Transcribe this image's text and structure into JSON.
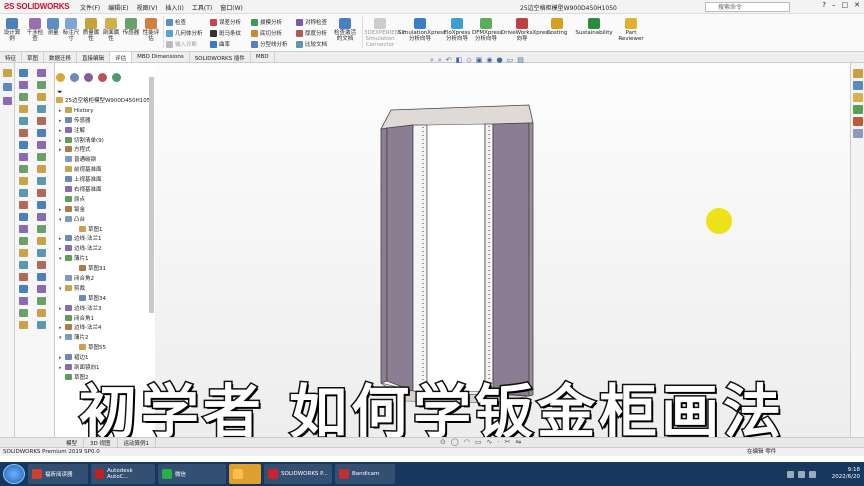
{
  "app": {
    "brand": "SOLIDWORKS",
    "document_title": "25边空格柜模型W900D450H1050",
    "search_placeholder": "搜索命令"
  },
  "menu": [
    "文件(F)",
    "编辑(E)",
    "视图(V)",
    "插入(I)",
    "工具(T)",
    "窗口(W)"
  ],
  "ribbon": {
    "left_buttons": [
      "设计算例",
      "干涉检查",
      "测量",
      "标注尺寸",
      "质量属性",
      "剖面属性",
      "传感器",
      "性能评估"
    ],
    "mid_col1": [
      "检查",
      "几何体分析",
      "输入诊断"
    ],
    "mid_col2": [
      "误差分析",
      "斑马条纹",
      "曲率"
    ],
    "mid_col3": [
      "拔模分析",
      "底切分析",
      "分型线分析"
    ],
    "mid_col4": [
      "对称检查",
      "厚度分析",
      "比较文档"
    ],
    "check_active": "检查激活的文档",
    "addins": [
      "3DEXPERIENCE Simulation Connector",
      "SimulationXpress 分析向导",
      "FloXpress 分析向导",
      "DFMXpress 分析向导",
      "DriveWorksXpress 向导",
      "Costing",
      "Sustainability",
      "Part Reviewer"
    ]
  },
  "tabs": [
    "特征",
    "草图",
    "数据迁移",
    "直接编辑",
    "评估",
    "MBD Dimensions",
    "SOLIDWORKS 插件",
    "MBD"
  ],
  "active_tab_index": 4,
  "tree": {
    "root": "25边空格柜模型W900D450H1050",
    "items": [
      {
        "tw": "▸",
        "label": "History",
        "indent": 0
      },
      {
        "tw": "▸",
        "label": "传感器",
        "indent": 0
      },
      {
        "tw": "▸",
        "label": "注解",
        "indent": 0
      },
      {
        "tw": "▸",
        "label": "切割清单(9)",
        "indent": 0
      },
      {
        "tw": "▸",
        "label": "方程式",
        "indent": 0
      },
      {
        "tw": "",
        "label": "普通碳钢",
        "indent": 0
      },
      {
        "tw": "",
        "label": "前视基准面",
        "indent": 0
      },
      {
        "tw": "",
        "label": "上视基准面",
        "indent": 0
      },
      {
        "tw": "",
        "label": "右视基准面",
        "indent": 0
      },
      {
        "tw": "",
        "label": "原点",
        "indent": 0
      },
      {
        "tw": "▸",
        "label": "钣金",
        "indent": 0
      },
      {
        "tw": "▾",
        "label": "凸台",
        "indent": 0
      },
      {
        "tw": "",
        "label": "草图1",
        "indent": 1
      },
      {
        "tw": "▸",
        "label": "边线-法兰1",
        "indent": 0
      },
      {
        "tw": "▸",
        "label": "边线-法兰2",
        "indent": 0
      },
      {
        "tw": "▾",
        "label": "薄片1",
        "indent": 0
      },
      {
        "tw": "",
        "label": "草图31",
        "indent": 1
      },
      {
        "tw": "",
        "label": "闭合角2",
        "indent": 0
      },
      {
        "tw": "▾",
        "label": "剪裁",
        "indent": 0
      },
      {
        "tw": "",
        "label": "草图34",
        "indent": 1
      },
      {
        "tw": "▸",
        "label": "边线-法兰3",
        "indent": 0
      },
      {
        "tw": "",
        "label": "闭合角1",
        "indent": 0
      },
      {
        "tw": "▸",
        "label": "边线-法兰4",
        "indent": 0
      },
      {
        "tw": "▾",
        "label": "薄片2",
        "indent": 0
      },
      {
        "tw": "",
        "label": "草图55",
        "indent": 1
      },
      {
        "tw": "▸",
        "label": "褶边1",
        "indent": 0
      },
      {
        "tw": "▸",
        "label": "剖面镜向1",
        "indent": 0
      },
      {
        "tw": "",
        "label": "草图2",
        "indent": 0
      }
    ]
  },
  "overlay_title": "初学者 如何学钣金柜画法",
  "bottom_tabs": [
    "模型",
    "3D 视图",
    "运动算例1"
  ],
  "status": {
    "left": "SOLIDWORKS Premium 2019 SP0.0",
    "right": "在编辑 零件"
  },
  "taskbar": {
    "items": [
      "福昕阅读器",
      "Autodesk AutoC...",
      "微信",
      "",
      "SOLIDWORKS P...",
      "Bandicam"
    ],
    "time": "9:18",
    "date": "2022/6/20"
  },
  "colors": {
    "brand_red": "#c8102e",
    "panel_fill": "#8c7e92",
    "taskbar": "#17375e",
    "cursor_highlight": "#ecdf00"
  }
}
